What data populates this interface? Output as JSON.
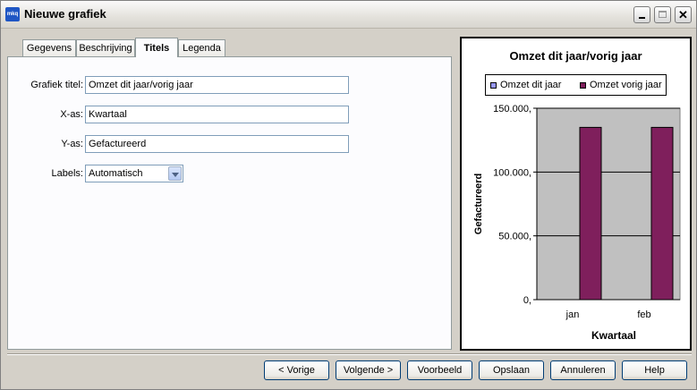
{
  "window": {
    "title": "Nieuwe grafiek",
    "icon_text": "mkq"
  },
  "tabs": [
    {
      "label": "Gegevens"
    },
    {
      "label": "Beschrijving"
    },
    {
      "label": "Titels",
      "active": true
    },
    {
      "label": "Legenda"
    }
  ],
  "form": {
    "title_label": "Grafiek titel:",
    "title_value": "Omzet dit jaar/vorig jaar",
    "xaxis_label": "X-as:",
    "xaxis_value": "Kwartaal",
    "yaxis_label": "Y-as:",
    "yaxis_value": "Gefactureerd",
    "labels_label": "Labels:",
    "labels_value": "Automatisch"
  },
  "chart_data": {
    "type": "bar",
    "title": "Omzet dit jaar/vorig jaar",
    "xlabel": "Kwartaal",
    "ylabel": "Gefactureerd",
    "categories": [
      "jan",
      "feb"
    ],
    "series": [
      {
        "name": "Omzet dit jaar",
        "color": "#9999ff",
        "values": [
          0,
          0
        ]
      },
      {
        "name": "Omzet vorig jaar",
        "color": "#7f1f5c",
        "values": [
          135000,
          135000
        ]
      }
    ],
    "ylim": [
      0,
      150000
    ],
    "yticks": [
      "0,",
      "50.000,",
      "100.000,",
      "150.000,"
    ],
    "ytick_values": [
      0,
      50000,
      100000,
      150000
    ],
    "grid": true,
    "plot_background": "#c0c0c0",
    "legend_position": "top"
  },
  "buttons": {
    "prev": "< Vorige",
    "next": "Volgende >",
    "preview": "Voorbeeld",
    "save": "Opslaan",
    "cancel": "Annuleren",
    "help": "Help"
  }
}
